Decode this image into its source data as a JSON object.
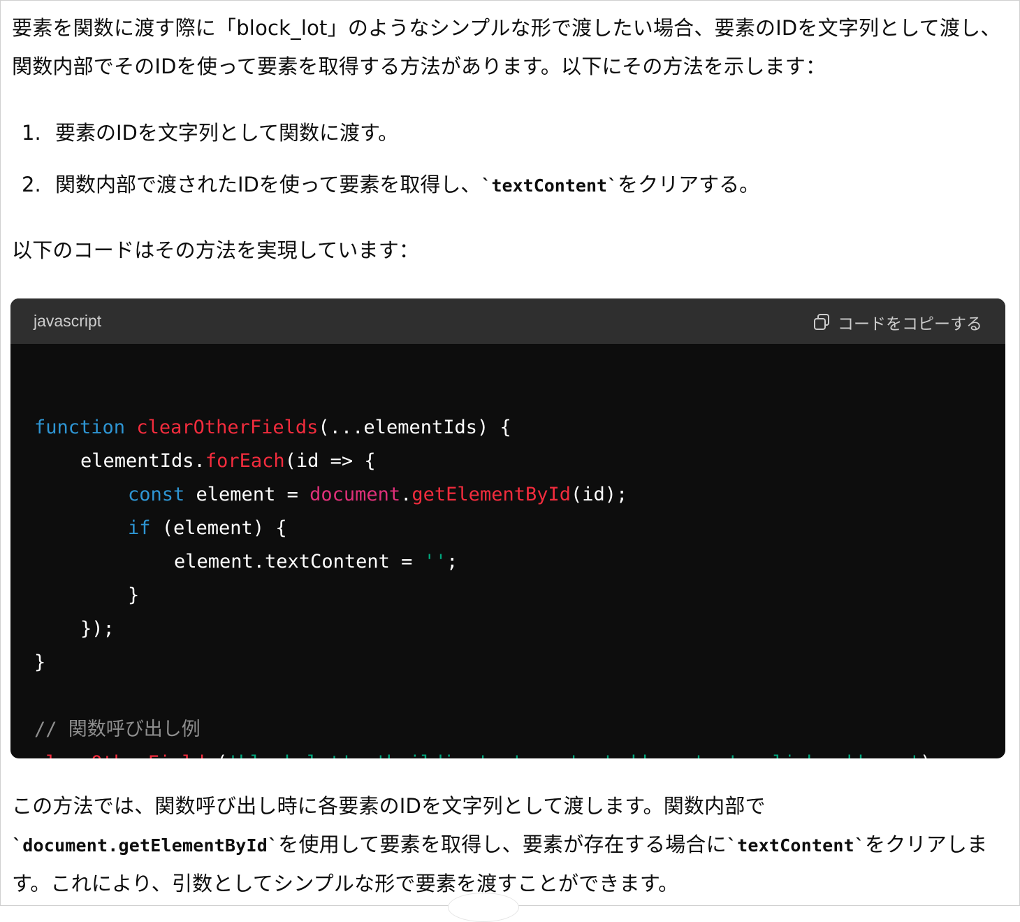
{
  "intro": {
    "text": "要素を関数に渡す際に「block_lot」のようなシンプルな形で渡したい場合、要素のIDを文字列として渡し、関数内部でそのIDを使って要素を取得する方法があります。以下にその方法を示します："
  },
  "steps": [
    {
      "num": "1.",
      "text": "要素のIDを文字列として関数に渡す。"
    },
    {
      "num": "2.",
      "text_before": "関数内部で渡されたIDを使って要素を取得し、",
      "code": "`textContent`",
      "text_after": "をクリアする。"
    }
  ],
  "lead": {
    "text": "以下のコードはその方法を実現しています："
  },
  "codeblock": {
    "language": "javascript",
    "copy_label": "コードをコピーする",
    "copy_icon": "copy-icon",
    "tokens": {
      "l1_kw": "function",
      "l1_fn": "clearOtherFields",
      "l1_rest": "(...elementIds) {",
      "l2_a": "elementIds.",
      "l2_fn": "forEach",
      "l2_rest": "(id => {",
      "l3_kw": "const",
      "l3_a": " element = ",
      "l3_obj": "document",
      "l3_dot": ".",
      "l3_fn": "getElementById",
      "l3_rest": "(id);",
      "l4_kw": "if",
      "l4_rest": " (element) {",
      "l5_a": "element.textContent = ",
      "l5_str": "''",
      "l5_rest": ";",
      "l6": "}",
      "l7": "});",
      "l8": "}",
      "l10_cm": "// 関数呼び出し例",
      "l11_fn": "clearOtherFields",
      "l11_p1": "(",
      "l11_s1": "'block_lot'",
      "l11_c1": ", ",
      "l11_s2": "'building'",
      "l11_c2": ", ",
      "l11_s3": "'room'",
      "l11_c3": ", ",
      "l11_s4": "'address'",
      "l11_c4": ", ",
      "l11_s5": "'english_address'",
      "l11_end": ");"
    }
  },
  "outro": {
    "t1": "この方法では、関数呼び出し時に各要素のIDを文字列として渡します。関数内部で",
    "c1": "`document.getElementById`",
    "t2": "を使用して要素を取得し、要素が存在する場合に",
    "c2": "`textContent`",
    "t3": "をクリアします。これにより、引数としてシンプルな形で要素を渡すことができます。"
  },
  "colors": {
    "code_bg": "#0d0d0d",
    "code_header_bg": "#2f2f2f",
    "keyword": "#2e95d3",
    "function": "#f22c3d",
    "object": "#df3079",
    "string": "#00a67d",
    "comment": "#8e8e8e"
  }
}
